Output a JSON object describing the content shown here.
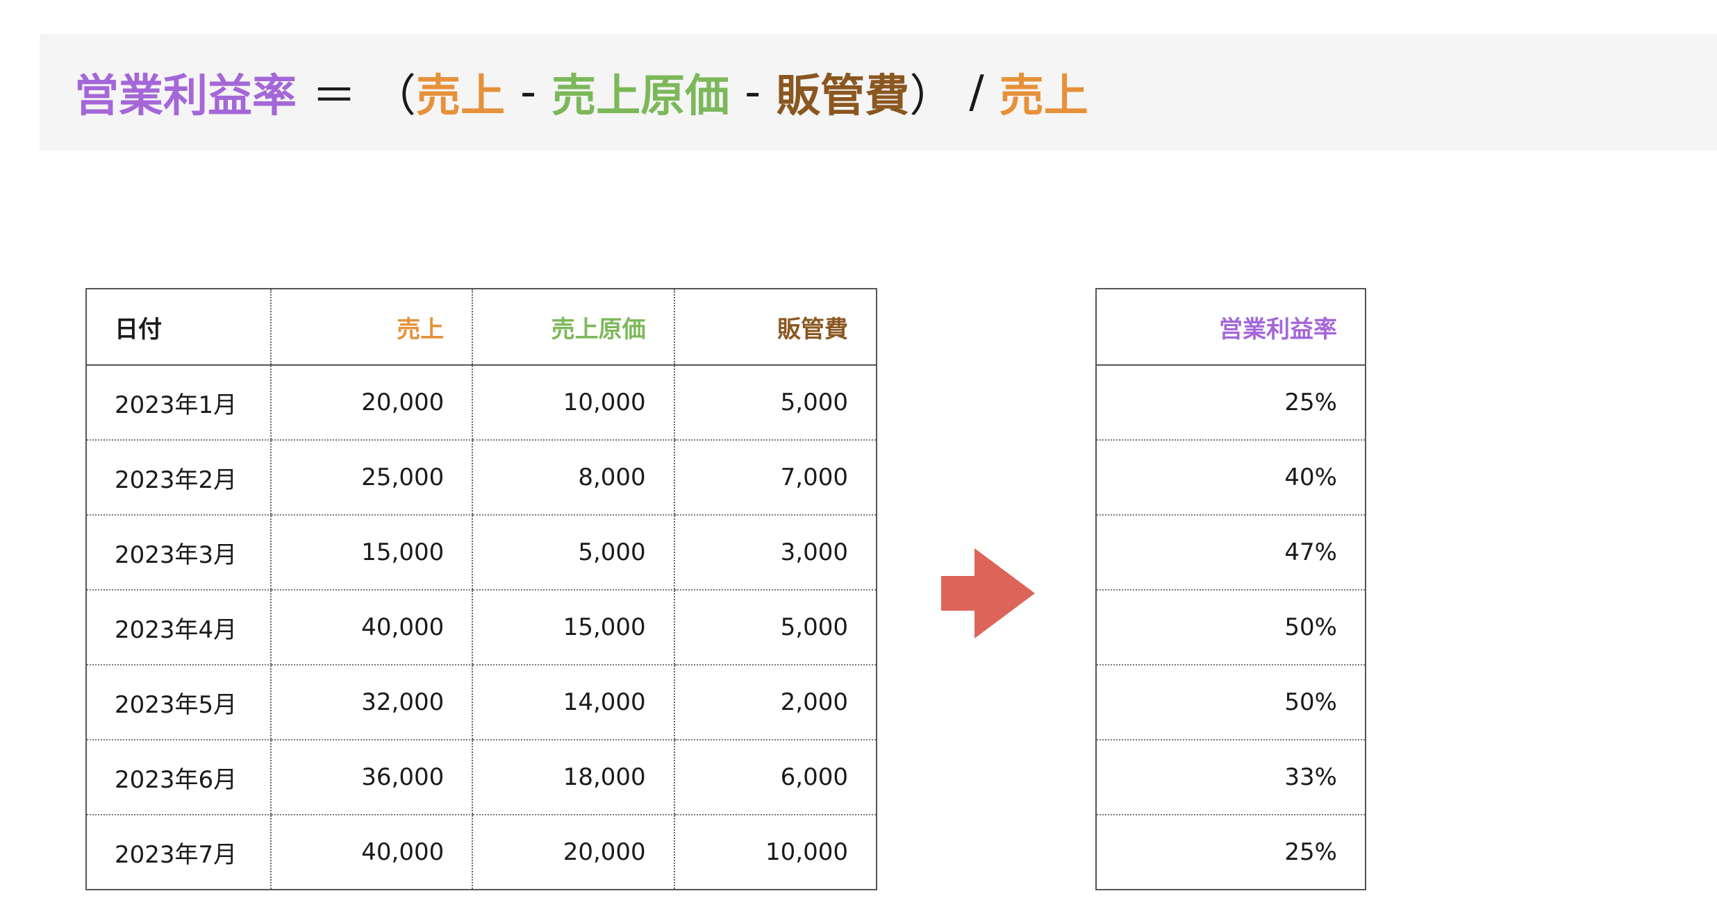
{
  "formula": {
    "result": "営業利益率",
    "equals": "＝",
    "open_paren": "（",
    "sales_1": "売上",
    "minus_1": "-",
    "cogs": "売上原価",
    "minus_2": "-",
    "sga": "販管費",
    "close_paren": "）",
    "divide": "/",
    "sales_2": "売上"
  },
  "colors": {
    "operating_margin": "#a467d8",
    "sales": "#e6913a",
    "cogs": "#7cb85a",
    "sga": "#8a5720",
    "arrow": "#dd6459"
  },
  "main_table": {
    "headers": {
      "date": "日付",
      "sales": "売上",
      "cogs": "売上原価",
      "sga": "販管費"
    },
    "rows": [
      {
        "date": "2023年1月",
        "sales": "20,000",
        "cogs": "10,000",
        "sga": "5,000"
      },
      {
        "date": "2023年2月",
        "sales": "25,000",
        "cogs": "8,000",
        "sga": "7,000"
      },
      {
        "date": "2023年3月",
        "sales": "15,000",
        "cogs": "5,000",
        "sga": "3,000"
      },
      {
        "date": "2023年4月",
        "sales": "40,000",
        "cogs": "15,000",
        "sga": "5,000"
      },
      {
        "date": "2023年5月",
        "sales": "32,000",
        "cogs": "14,000",
        "sga": "2,000"
      },
      {
        "date": "2023年6月",
        "sales": "36,000",
        "cogs": "18,000",
        "sga": "6,000"
      },
      {
        "date": "2023年7月",
        "sales": "40,000",
        "cogs": "20,000",
        "sga": "10,000"
      }
    ]
  },
  "arrow_icon": "right-arrow-icon",
  "result_table": {
    "header": "営業利益率",
    "rows": [
      "25%",
      "40%",
      "47%",
      "50%",
      "50%",
      "33%",
      "25%"
    ]
  }
}
